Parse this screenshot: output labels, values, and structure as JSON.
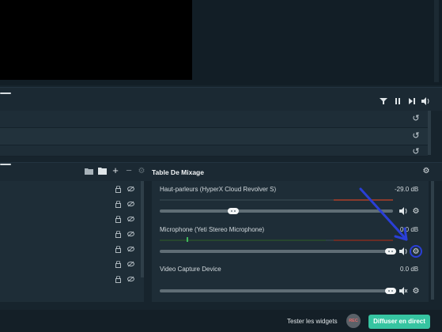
{
  "mixer": {
    "title": "Table De Mixage",
    "sources": [
      {
        "name": "Haut-parleurs (HyperX Cloud Revolver S)",
        "db": "-29.0 dB",
        "volume": 0.32
      },
      {
        "name": "Microphone (Yeti Stereo Microphone)",
        "db": "0.0 dB",
        "volume": 1.0
      },
      {
        "name": "Video Capture Device",
        "db": "0.0 dB",
        "volume": 1.0
      }
    ]
  },
  "footer": {
    "test_widgets": "Tester les widgets",
    "rec": "REC",
    "go_live": "Diffuser en direct"
  },
  "icons": {
    "filter": "filter-icon",
    "pause": "pause-icon",
    "next": "skip-icon",
    "speaker": "speaker-icon",
    "reset": "reset-icon",
    "gear": "gear-icon",
    "lock": "lock-icon",
    "visibility": "eye-off-icon",
    "add": "plus-icon",
    "remove": "minus-icon",
    "folder": "folder-add-icon"
  },
  "colors": {
    "accent": "#36c4a1",
    "annotation": "#2a3fd6",
    "meter_green": "#2f7a3a",
    "meter_red": "#8a3a2c"
  }
}
